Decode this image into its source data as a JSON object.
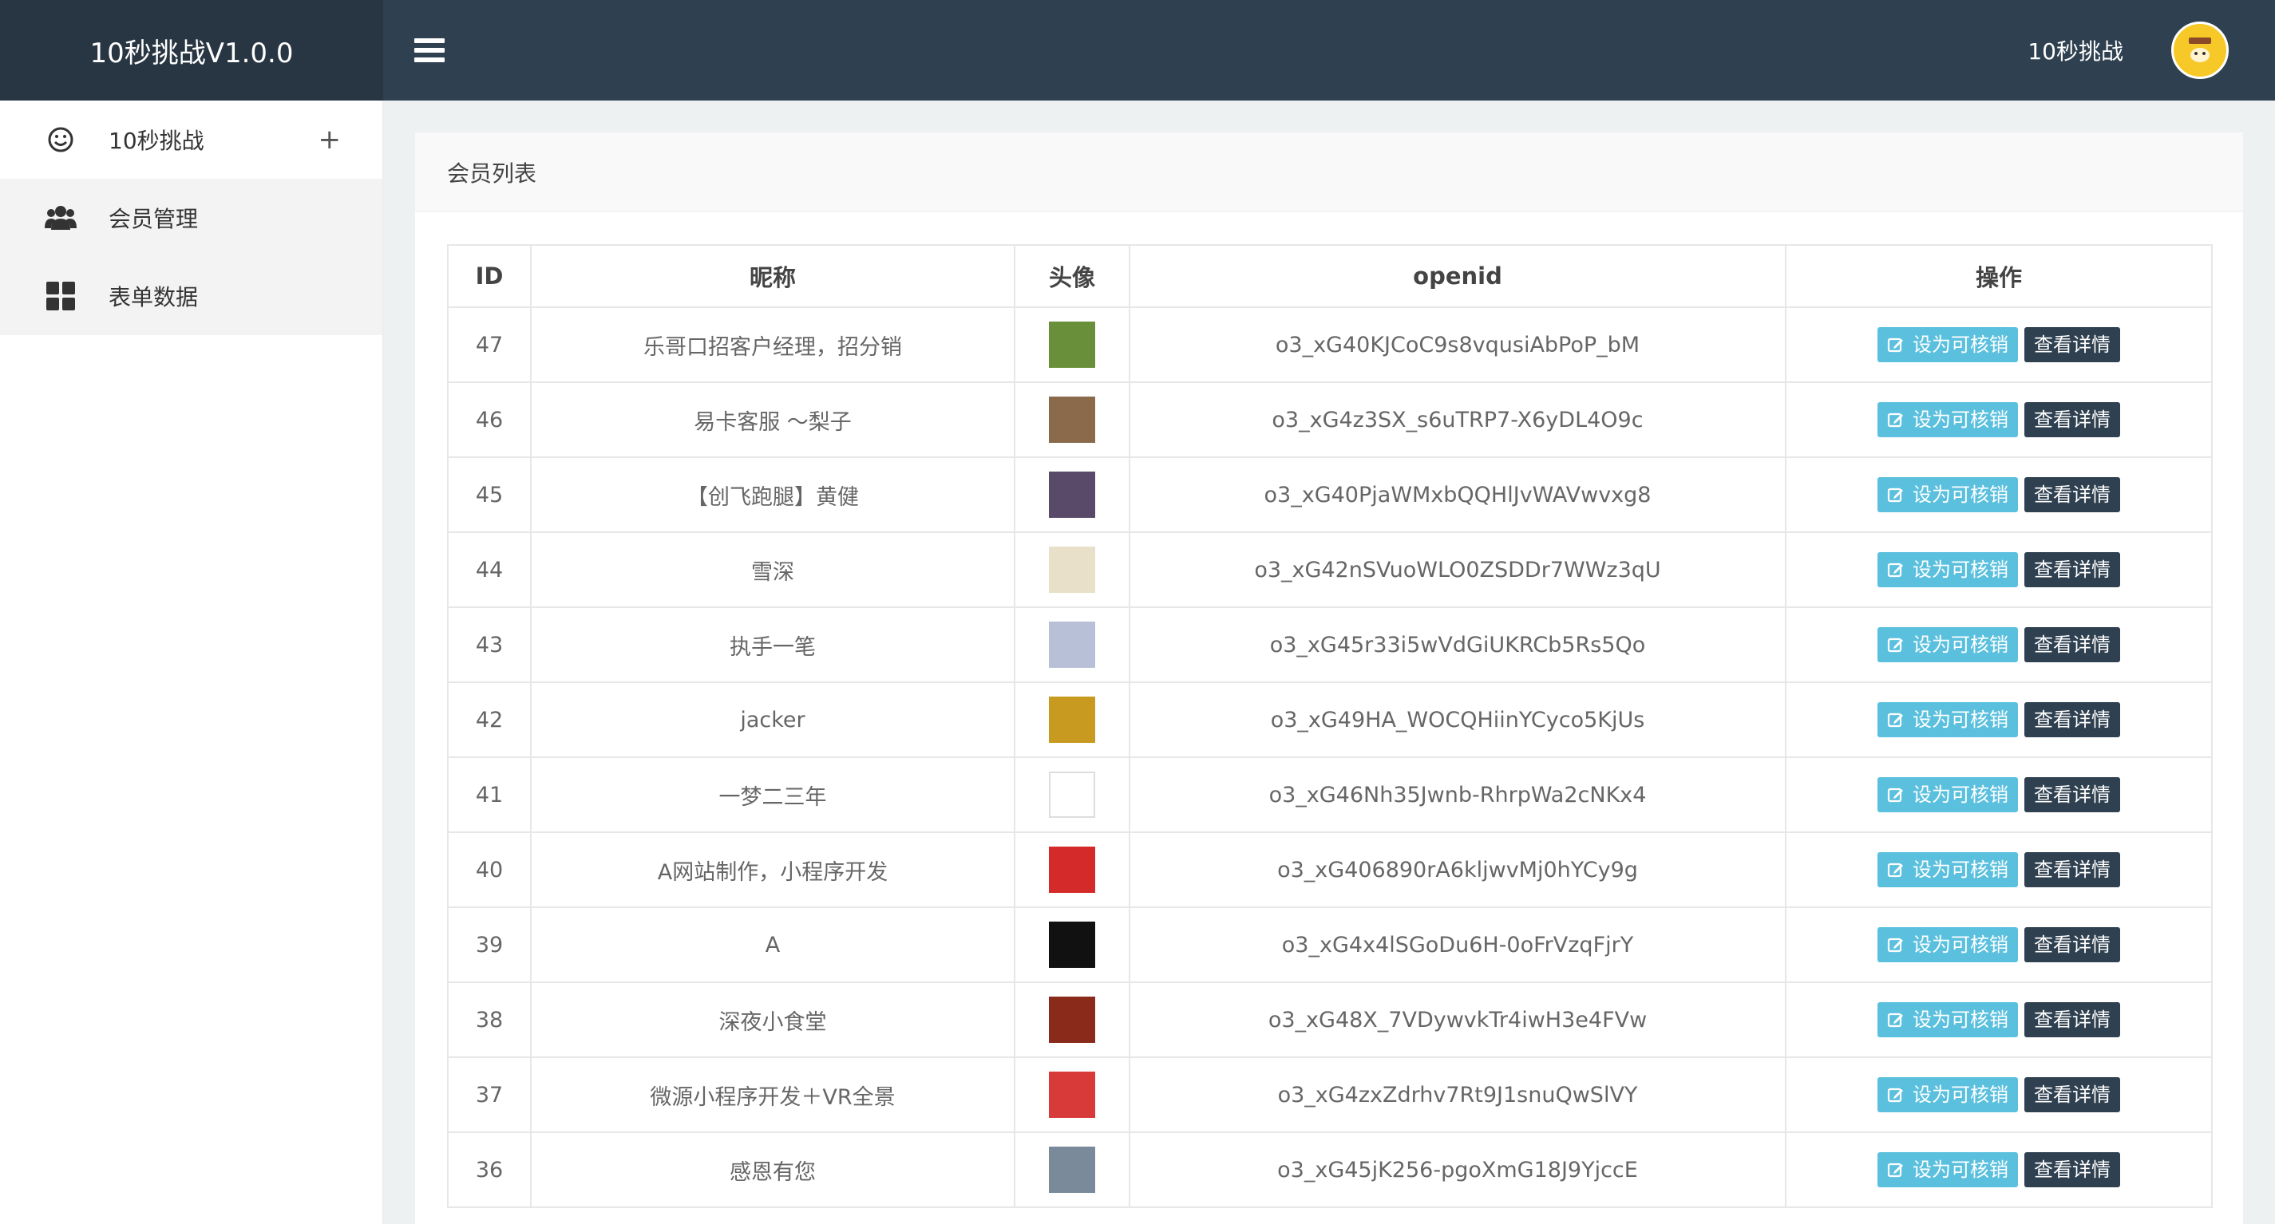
{
  "header": {
    "brand": "10秒挑战V1.0.0",
    "user_name": "10秒挑战"
  },
  "sidebar": {
    "items": [
      {
        "label": "10秒挑战",
        "icon": "smile-icon",
        "expand": "+"
      },
      {
        "label": "会员管理",
        "icon": "users-icon"
      },
      {
        "label": "表单数据",
        "icon": "grid-icon"
      }
    ]
  },
  "panel": {
    "title": "会员列表",
    "columns": [
      "ID",
      "昵称",
      "头像",
      "openid",
      "操作"
    ],
    "verify_label": "设为可核销",
    "detail_label": "查看详情",
    "rows": [
      {
        "id": "47",
        "nickname": "乐哥口招客户经理，招分销",
        "openid": "o3_xG40KJCoC9s8vqusiAbPoP_bM",
        "avatar_color": "#6a8f3a"
      },
      {
        "id": "46",
        "nickname": "易卡客服 ～梨子",
        "openid": "o3_xG4z3SX_s6uTRP7-X6yDL4O9c",
        "avatar_color": "#8a6a4a"
      },
      {
        "id": "45",
        "nickname": "【创飞跑腿】黄健",
        "openid": "o3_xG40PjaWMxbQQHlJvWAVwvxg8",
        "avatar_color": "#5a4a6a"
      },
      {
        "id": "44",
        "nickname": "雪深",
        "openid": "o3_xG42nSVuoWLO0ZSDDr7WWz3qU",
        "avatar_color": "#e8e0c8"
      },
      {
        "id": "43",
        "nickname": "执手一笔",
        "openid": "o3_xG45r33i5wVdGiUKRCb5Rs5Qo",
        "avatar_color": "#b8c0d8"
      },
      {
        "id": "42",
        "nickname": "jacker",
        "openid": "o3_xG49HA_WOCQHiinYCyco5KjUs",
        "avatar_color": "#c89a20"
      },
      {
        "id": "41",
        "nickname": "一梦二三年",
        "openid": "o3_xG46Nh35Jwnb-RhrpWa2cNKx4",
        "avatar_color": "#ffffff"
      },
      {
        "id": "40",
        "nickname": "A网站制作，小程序开发",
        "openid": "o3_xG406890rA6kljwvMj0hYCy9g",
        "avatar_color": "#d42a2a"
      },
      {
        "id": "39",
        "nickname": "A",
        "openid": "o3_xG4x4lSGoDu6H-0oFrVzqFjrY",
        "avatar_color": "#111111"
      },
      {
        "id": "38",
        "nickname": "深夜小食堂",
        "openid": "o3_xG48X_7VDywvkTr4iwH3e4FVw",
        "avatar_color": "#8a2a1a"
      },
      {
        "id": "37",
        "nickname": "微源小程序开发＋VR全景",
        "openid": "o3_xG4zxZdrhv7Rt9J1snuQwSlVY",
        "avatar_color": "#d83a3a"
      },
      {
        "id": "36",
        "nickname": "感恩有您",
        "openid": "o3_xG45jK256-pgoXmG18J9YjccE",
        "avatar_color": "#7a8a9a"
      }
    ]
  }
}
